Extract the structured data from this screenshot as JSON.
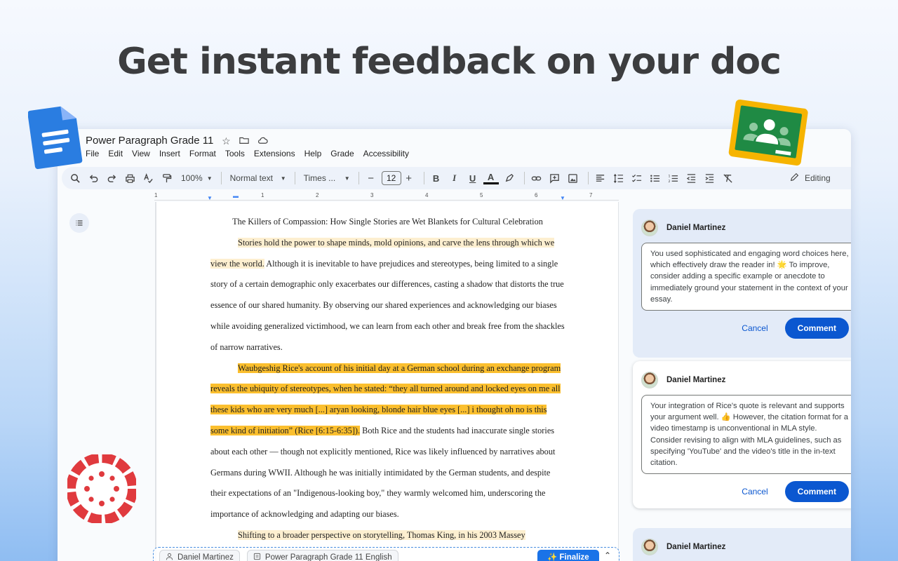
{
  "hero": {
    "title": "Get instant feedback on your doc"
  },
  "doc_header": {
    "title": "Power Paragraph Grade 11",
    "menus": [
      "File",
      "Edit",
      "View",
      "Insert",
      "Format",
      "Tools",
      "Extensions",
      "Help",
      "Grade",
      "Accessibility"
    ]
  },
  "toolbar": {
    "zoom": "100%",
    "style": "Normal text",
    "font": "Times ...",
    "font_size": "12",
    "mode": "Editing"
  },
  "ruler": {
    "numbers": [
      "1",
      "1",
      "2",
      "3",
      "4",
      "5",
      "6",
      "7"
    ]
  },
  "document": {
    "heading": "The Killers of Compassion: How Single Stories are Wet Blankets for Cultural Celebration",
    "p1_highlight": "Stories hold the power to shape minds, mold opinions, and carve the lens through which we view the world.",
    "p1_rest": " Although it is inevitable to have prejudices and stereotypes, being limited to a single story of a certain demographic only exacerbates our differences, casting a shadow that distorts the true essence of our shared humanity. By observing our shared experiences and acknowledging our biases while avoiding generalized victimhood, we can learn from each other and break free from the shackles of narrow narratives.",
    "p2_highlight": "Waubgeshig Rice's account of his initial day at a German school during an exchange program reveals the ubiquity of stereotypes, when he stated: “they all turned around and locked eyes on me all these kids who are very much [...] aryan looking, blonde hair blue eyes [...] i thought oh no is this some kind of initiation” (Rice [6:15-6:35]).",
    "p2_rest": " Both Rice and the students had inaccurate single stories about each other — though not explicitly mentioned, Rice was likely influenced by narratives about Germans during WWII. Although he was initially intimidated by the German students, and despite their expectations of an \"Indigenous-looking boy,\" they warmly welcomed him, underscoring the importance of acknowledging and adapting our biases.",
    "p3_highlight": "Shifting to a broader perspective on storytelling, Thomas King, in his 2003 Massey"
  },
  "comments": [
    {
      "author": "Daniel Martinez",
      "text": "You used sophisticated and engaging word choices here, which effectively draw the reader in! 🌟 To improve, consider adding a specific example or anecdote to immediately ground your statement in the context of your essay.",
      "cancel": "Cancel",
      "submit": "Comment"
    },
    {
      "author": "Daniel Martinez",
      "text": "Your integration of Rice's quote is relevant and supports your argument well. 👍 However, the citation format for a video timestamp is unconventional in MLA style. Consider revising to align with MLA guidelines, such as specifying 'YouTube' and the video's title in the in-text citation.",
      "cancel": "Cancel",
      "submit": "Comment"
    },
    {
      "author": "Daniel Martinez"
    }
  ],
  "bottom_bar": {
    "student": "Daniel Martinez",
    "document": "Power Paragraph Grade 11 English",
    "finalize": "Finalize"
  },
  "colors": {
    "accent": "#0b57d0",
    "highlight_light": "#fdefd0",
    "highlight_strong": "#fbbf2e",
    "canvas_red": "#e03a3e",
    "classroom_green": "#1f8a44",
    "classroom_yellow": "#f6b400",
    "docs_blue": "#2a7de1"
  },
  "icons": [
    "search-icon",
    "undo-icon",
    "redo-icon",
    "print-icon",
    "spellcheck-icon",
    "paint-format-icon",
    "bold-icon",
    "italic-icon",
    "underline-icon",
    "text-color-icon",
    "highlight-icon",
    "link-icon",
    "add-comment-icon",
    "image-icon",
    "align-icon",
    "line-spacing-icon",
    "checklist-icon",
    "bullet-list-icon",
    "numbered-list-icon",
    "decrease-indent-icon",
    "increase-indent-icon",
    "clear-format-icon",
    "pencil-icon",
    "star-icon",
    "folder-icon",
    "cloud-icon",
    "outline-icon",
    "person-icon",
    "doc-icon",
    "sparkle-icon",
    "chevron-up-icon"
  ]
}
